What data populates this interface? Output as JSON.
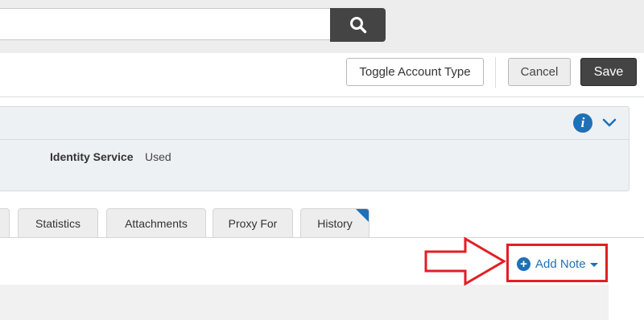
{
  "search": {
    "value": "",
    "placeholder": "",
    "icon": "search-icon"
  },
  "toolbar": {
    "toggle_label": "Toggle Account Type",
    "cancel_label": "Cancel",
    "save_label": "Save"
  },
  "info_panel": {
    "info_icon": "info-icon",
    "info_glyph": "i",
    "collapse_icon": "chevron-down-icon",
    "field_label": "Identity Service",
    "field_value": "Used"
  },
  "tabs": [
    {
      "label": ""
    },
    {
      "label": "Statistics"
    },
    {
      "label": "Attachments"
    },
    {
      "label": "Proxy For"
    },
    {
      "label": "History"
    }
  ],
  "notes": {
    "add_note_label": "Add Note",
    "plus_glyph": "+",
    "icon": "plus-circle-icon",
    "dropdown_icon": "caret-down-icon"
  },
  "annotation": {
    "color": "#e31e24",
    "shape": "arrow-and-box"
  },
  "colors": {
    "accent": "#1f70b6",
    "save_button": "#444444",
    "highlight": "#e31e24"
  }
}
